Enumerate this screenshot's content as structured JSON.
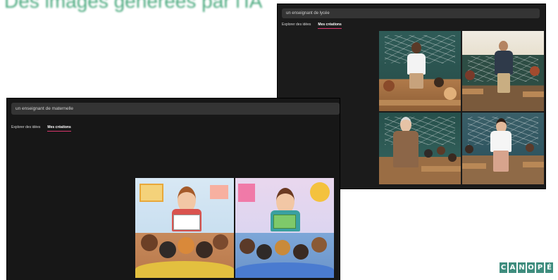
{
  "slide": {
    "title": "Des images générées par l'IA",
    "logo_letters": [
      "C",
      "A",
      "N",
      "O",
      "P",
      "É"
    ]
  },
  "back_window": {
    "search_value": "un enseignant de lycée",
    "tabs": [
      {
        "label": "Explorer des idées",
        "active": false
      },
      {
        "label": "Mes créations",
        "active": true
      }
    ]
  },
  "front_window": {
    "search_value": "un enseignant de maternelle",
    "tabs": [
      {
        "label": "Explorer des idées",
        "active": false
      },
      {
        "label": "Mes créations",
        "active": true
      }
    ]
  },
  "colors": {
    "accent_tab": "#d8366c",
    "logo": "#3f8d7e",
    "title": "#2e9c6a"
  }
}
